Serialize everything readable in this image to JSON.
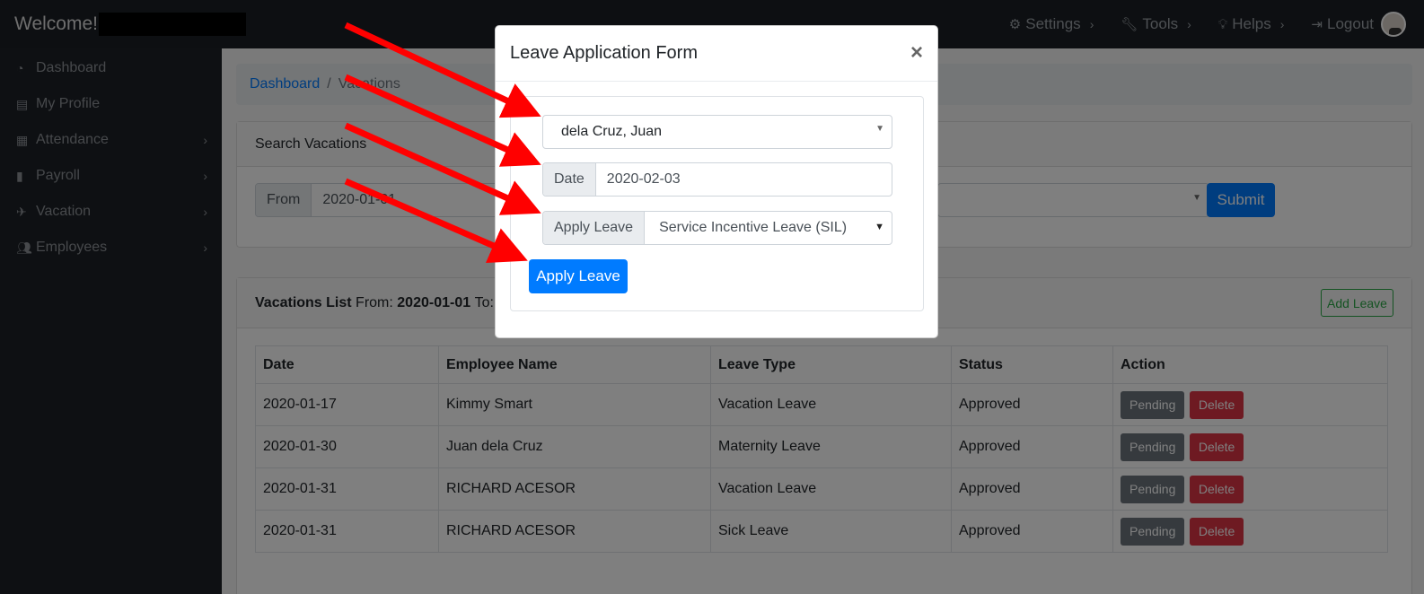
{
  "topbar": {
    "welcome": "Welcome!",
    "nav": [
      {
        "label": "Settings",
        "icon": "gears-icon"
      },
      {
        "label": "Tools",
        "icon": "wrench-icon"
      },
      {
        "label": "Helps",
        "icon": "lightbulb-icon"
      },
      {
        "label": "Logout",
        "icon": "sign-out-icon"
      }
    ]
  },
  "sidebar": {
    "items": [
      {
        "label": "Dashboard",
        "icon": "tachometer-icon",
        "has_submenu": false
      },
      {
        "label": "My Profile",
        "icon": "id-card-icon",
        "has_submenu": false
      },
      {
        "label": "Attendance",
        "icon": "calendar-icon",
        "has_submenu": true
      },
      {
        "label": "Payroll",
        "icon": "file-icon",
        "has_submenu": true
      },
      {
        "label": "Vacation",
        "icon": "plane-icon",
        "has_submenu": true
      },
      {
        "label": "Employees",
        "icon": "users-icon",
        "has_submenu": true
      }
    ]
  },
  "breadcrumb": {
    "root": "Dashboard",
    "current": "Vacations"
  },
  "search": {
    "title": "Search Vacations",
    "from_label": "From",
    "from_value": "2020-01-01",
    "submit_label": "Submit"
  },
  "list": {
    "title": "Vacations List",
    "from_label": "From:",
    "from_value": "2020-01-01",
    "to_label": "To:",
    "add_label": "Add Leave",
    "columns": [
      "Date",
      "Employee Name",
      "Leave Type",
      "Status",
      "Action"
    ],
    "rows": [
      {
        "date": "2020-01-17",
        "name": "Kimmy Smart",
        "type": "Vacation Leave",
        "status": "Approved"
      },
      {
        "date": "2020-01-30",
        "name": "Juan dela Cruz",
        "type": "Maternity Leave",
        "status": "Approved"
      },
      {
        "date": "2020-01-31",
        "name": "RICHARD ACESOR",
        "type": "Vacation Leave",
        "status": "Approved"
      },
      {
        "date": "2020-01-31",
        "name": "RICHARD ACESOR",
        "type": "Sick Leave",
        "status": "Approved"
      }
    ],
    "pending_label": "Pending",
    "delete_label": "Delete"
  },
  "modal": {
    "title": "Leave Application Form",
    "close": "×",
    "employee_value": "dela Cruz, Juan",
    "date_label": "Date",
    "date_value": "2020-02-03",
    "apply_label": "Apply Leave",
    "leave_type_value": "Service Incentive Leave (SIL)",
    "submit_label": "Apply Leave"
  },
  "colors": {
    "primary": "#007bff",
    "danger": "#dc3545",
    "secondary": "#6c757d",
    "success": "#28a745",
    "annotation_arrow": "#ff0000"
  }
}
